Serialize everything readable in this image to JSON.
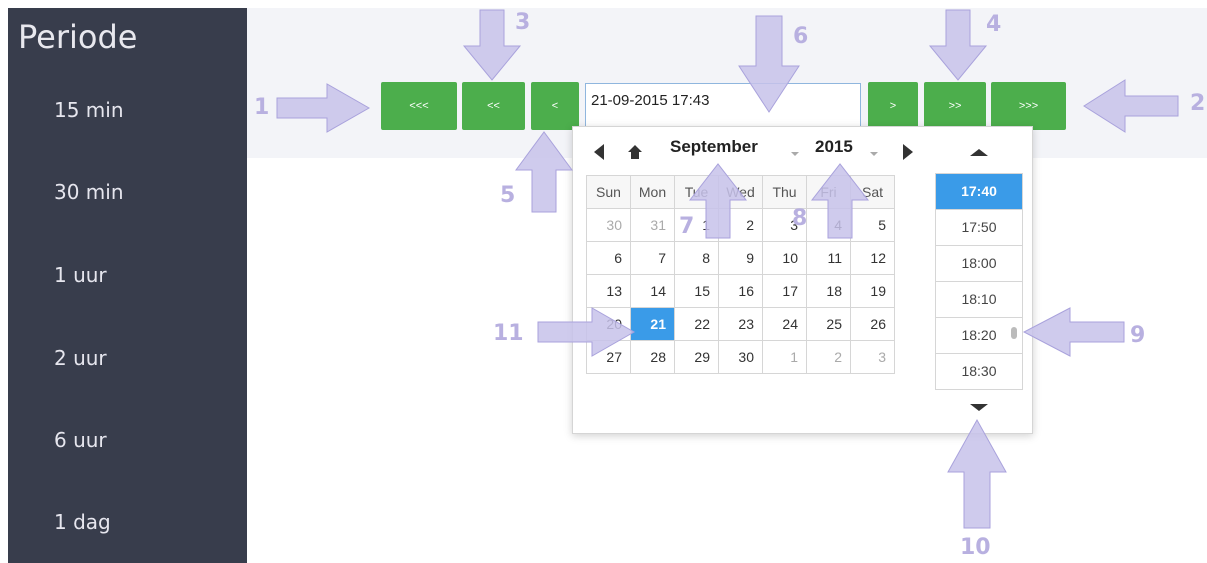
{
  "sidebar": {
    "title": "Periode",
    "items": [
      "15 min",
      "30 min",
      "1 uur",
      "2 uur",
      "6 uur",
      "1 dag"
    ]
  },
  "nav_buttons": {
    "back_far": "<<<",
    "back_mid": "<<",
    "back_one": "<",
    "fwd_one": ">",
    "fwd_mid": ">>",
    "fwd_far": ">>>"
  },
  "date_input": {
    "value": "21-09-2015 17:43"
  },
  "picker": {
    "month": "September",
    "year": "2015",
    "weekdays": [
      "Sun",
      "Mon",
      "Tue",
      "Wed",
      "Thu",
      "Fri",
      "Sat"
    ],
    "weeks": [
      [
        "30",
        "31",
        "1",
        "2",
        "3",
        "4",
        "5"
      ],
      [
        "6",
        "7",
        "8",
        "9",
        "10",
        "11",
        "12"
      ],
      [
        "13",
        "14",
        "15",
        "16",
        "17",
        "18",
        "19"
      ],
      [
        "20",
        "21",
        "22",
        "23",
        "24",
        "25",
        "26"
      ],
      [
        "27",
        "28",
        "29",
        "30",
        "1",
        "2",
        "3"
      ]
    ],
    "selected_day": "21",
    "times": [
      "17:40",
      "17:50",
      "18:00",
      "18:10",
      "18:20",
      "18:30"
    ],
    "selected_time": "17:40"
  },
  "annotations": [
    "1",
    "2",
    "3",
    "4",
    "5",
    "6",
    "7",
    "8",
    "9",
    "10",
    "11"
  ],
  "colors": {
    "sidebar": "#383d4c",
    "button": "#4cae4c",
    "selected": "#3a9be8",
    "annotation": "#b8b0e0"
  }
}
